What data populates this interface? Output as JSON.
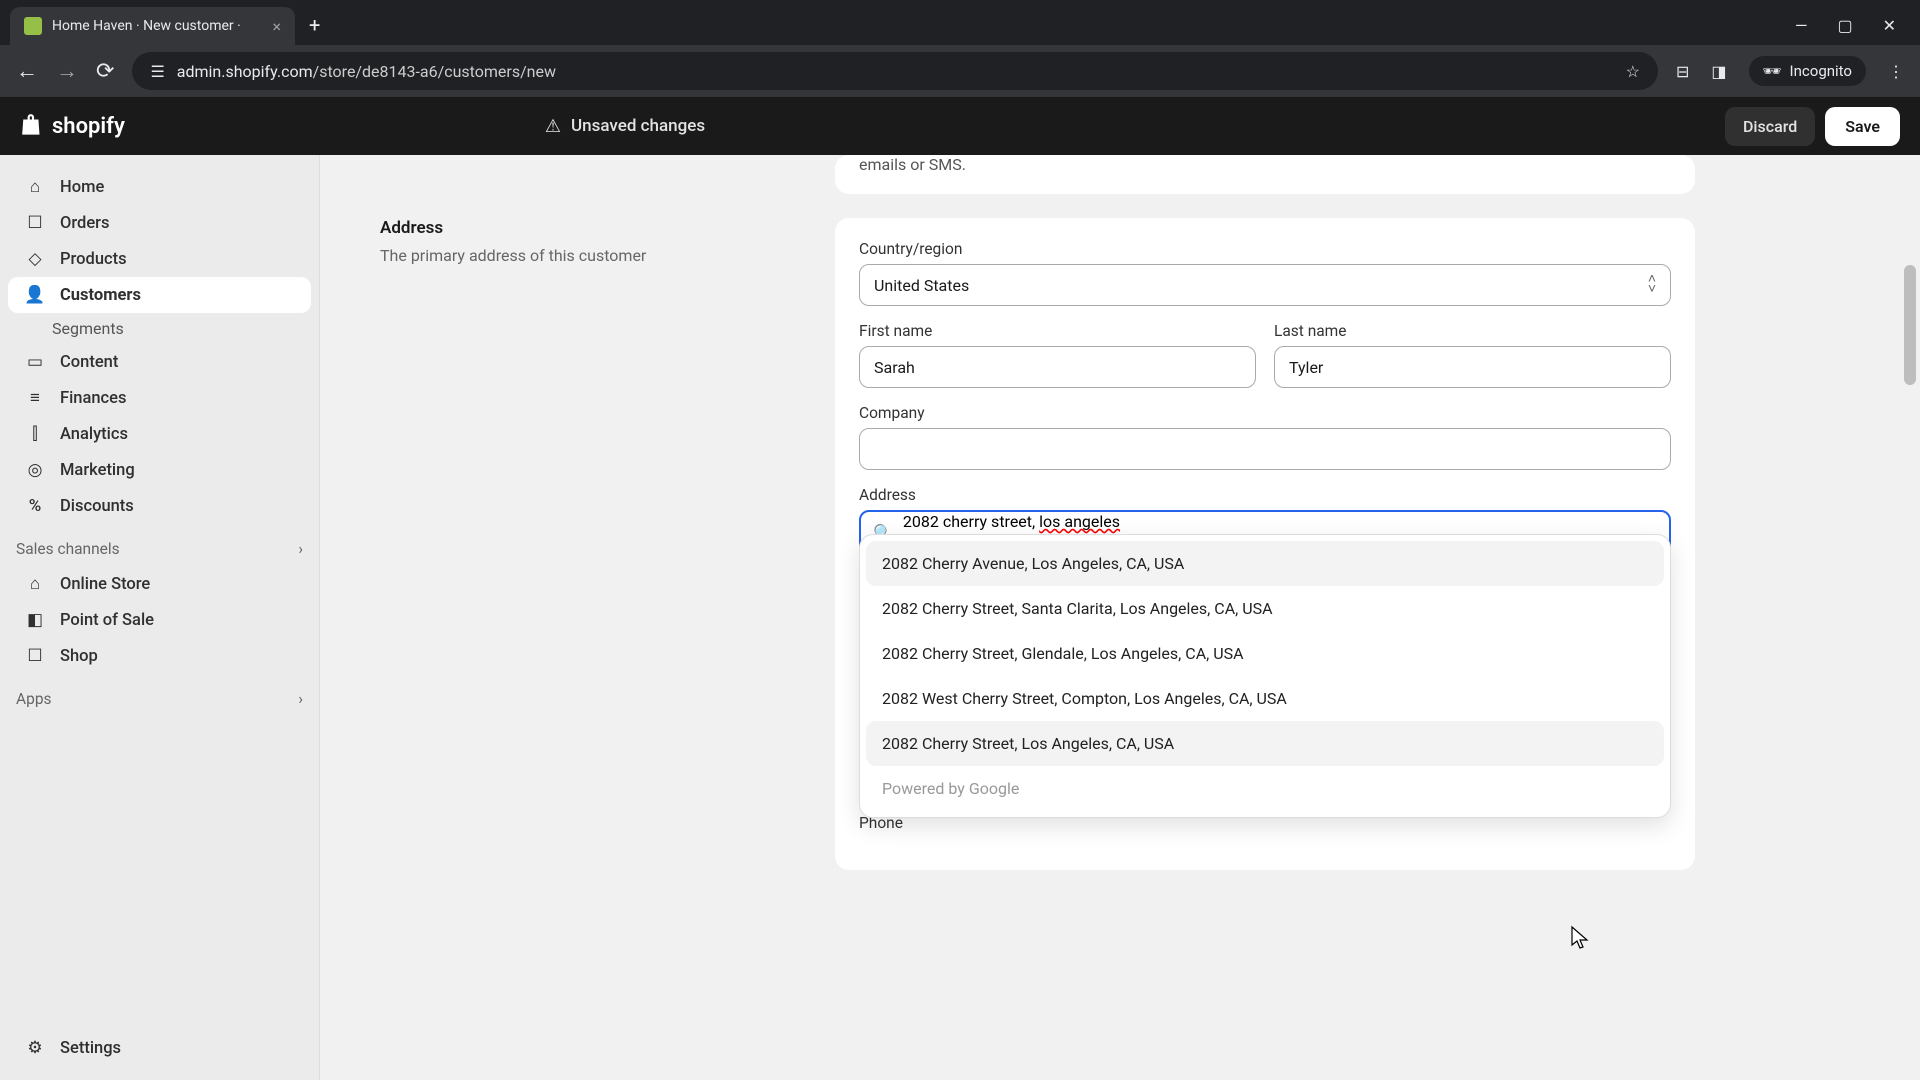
{
  "browser": {
    "tab_title": "Home Haven · New customer ·",
    "url_prefix": "admin.shopify.com",
    "url_path": "/store/de8143-a6/customers/new",
    "incognito_label": "Incognito"
  },
  "topbar": {
    "logo_text": "shopify",
    "unsaved_label": "Unsaved changes",
    "discard_label": "Discard",
    "save_label": "Save"
  },
  "sidebar": {
    "items": [
      {
        "icon": "⌂",
        "label": "Home"
      },
      {
        "icon": "☐",
        "label": "Orders"
      },
      {
        "icon": "◇",
        "label": "Products"
      },
      {
        "icon": "👤",
        "label": "Customers",
        "active": true
      },
      {
        "icon": "▭",
        "label": "Content"
      },
      {
        "icon": "≡",
        "label": "Finances"
      },
      {
        "icon": "⫿",
        "label": "Analytics"
      },
      {
        "icon": "◎",
        "label": "Marketing"
      },
      {
        "icon": "%",
        "label": "Discounts"
      }
    ],
    "customers_sub": "Segments",
    "sales_channels_label": "Sales channels",
    "channels": [
      {
        "icon": "⌂",
        "label": "Online Store"
      },
      {
        "icon": "◧",
        "label": "Point of Sale"
      },
      {
        "icon": "☐",
        "label": "Shop"
      }
    ],
    "apps_label": "Apps",
    "settings_label": "Settings",
    "settings_icon": "⚙"
  },
  "info_text": "emails or SMS.",
  "section": {
    "title": "Address",
    "desc": "The primary address of this customer"
  },
  "form": {
    "country_label": "Country/region",
    "country_value": "United States",
    "first_name_label": "First name",
    "first_name_value": "Sarah",
    "last_name_label": "Last name",
    "last_name_value": "Tyler",
    "company_label": "Company",
    "company_value": "",
    "address_label": "Address",
    "address_value_plain": "2082 cherry street, ",
    "address_value_spell": "los angeles",
    "phone_label": "Phone"
  },
  "autocomplete": {
    "items": [
      "2082 Cherry Avenue, Los Angeles, CA, USA",
      "2082 Cherry Street, Santa Clarita, Los Angeles, CA, USA",
      "2082 Cherry Street, Glendale, Los Angeles, CA, USA",
      "2082 West Cherry Street, Compton, Los Angeles, CA, USA",
      "2082 Cherry Street, Los Angeles, CA, USA"
    ],
    "footer": "Powered by Google"
  }
}
